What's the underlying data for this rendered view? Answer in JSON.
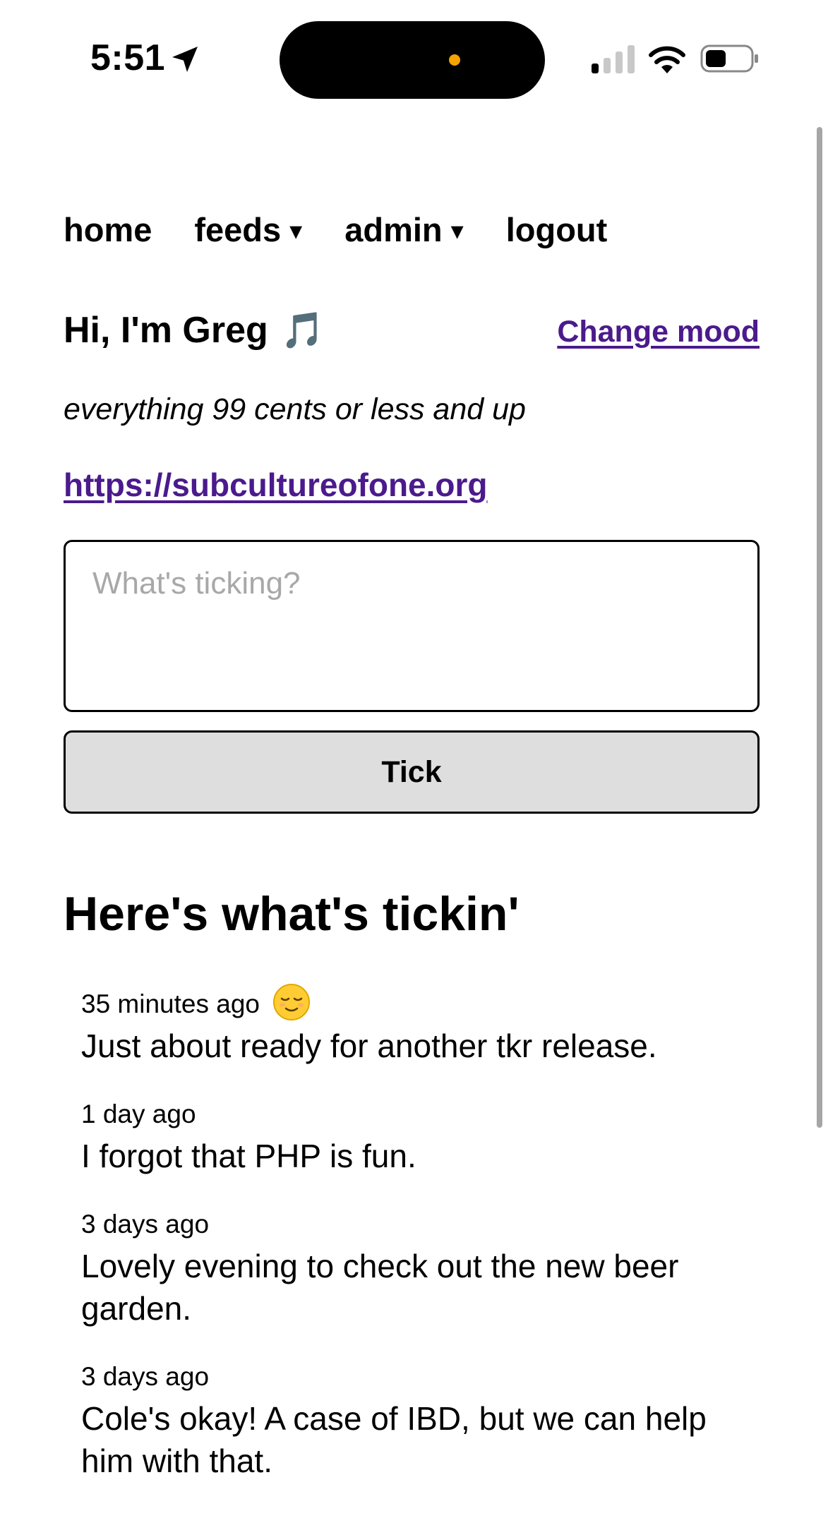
{
  "status_bar": {
    "time": "5:51",
    "icons": [
      "location-arrow-icon",
      "cellular-signal-icon",
      "wifi-icon",
      "battery-icon"
    ]
  },
  "nav": {
    "home": "home",
    "feeds": "feeds",
    "admin": "admin",
    "logout": "logout",
    "caret": "▾"
  },
  "profile": {
    "greeting": "Hi, I'm Greg",
    "mood": "🎵",
    "change_mood": "Change mood",
    "tagline": "everything 99 cents or less and up",
    "url": "https://subcultureofone.org"
  },
  "compose": {
    "placeholder": "What's ticking?",
    "value": "",
    "button_label": "Tick"
  },
  "feed": {
    "heading": "Here's what's tickin'",
    "items": [
      {
        "time": "35 minutes ago",
        "mood": "relieved-face-emoji",
        "text": "Just about ready for another tkr release."
      },
      {
        "time": "1 day ago",
        "text": "I forgot that PHP is fun."
      },
      {
        "time": "3 days ago",
        "text": "Lovely evening to check out the new beer garden."
      },
      {
        "time": "3 days ago",
        "text": "Cole's okay! A case of IBD, but we can help him with that."
      }
    ]
  },
  "colors": {
    "link": "#4b1a8c",
    "button_bg": "#dedede",
    "placeholder": "#a8a8a8",
    "island_dot": "#f5a300"
  }
}
